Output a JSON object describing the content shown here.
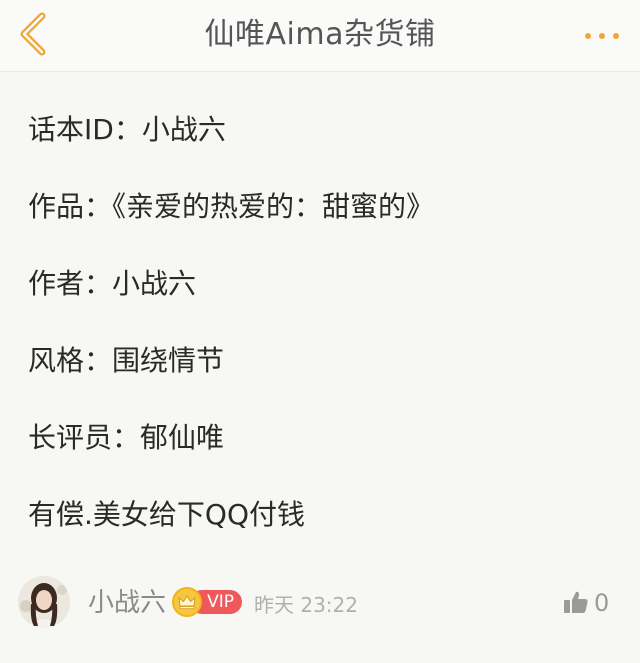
{
  "header": {
    "title": "仙唯Aima杂货铺",
    "back_icon": "chevron-left-icon",
    "more_icon": "more-dots-icon",
    "accent_color": "#f0a535"
  },
  "post": {
    "lines": [
      "话本ID：小战六",
      "作品：《亲爱的热爱的：甜蜜的》",
      "作者：小战六",
      "风格：围绕情节",
      "长评员：郁仙唯",
      "有偿.美女给下QQ付钱"
    ]
  },
  "footer": {
    "author": "小战六",
    "vip_label": "VIP",
    "timestamp": "昨天 23:22",
    "like_count": "0",
    "like_icon": "thumbs-up-icon"
  }
}
